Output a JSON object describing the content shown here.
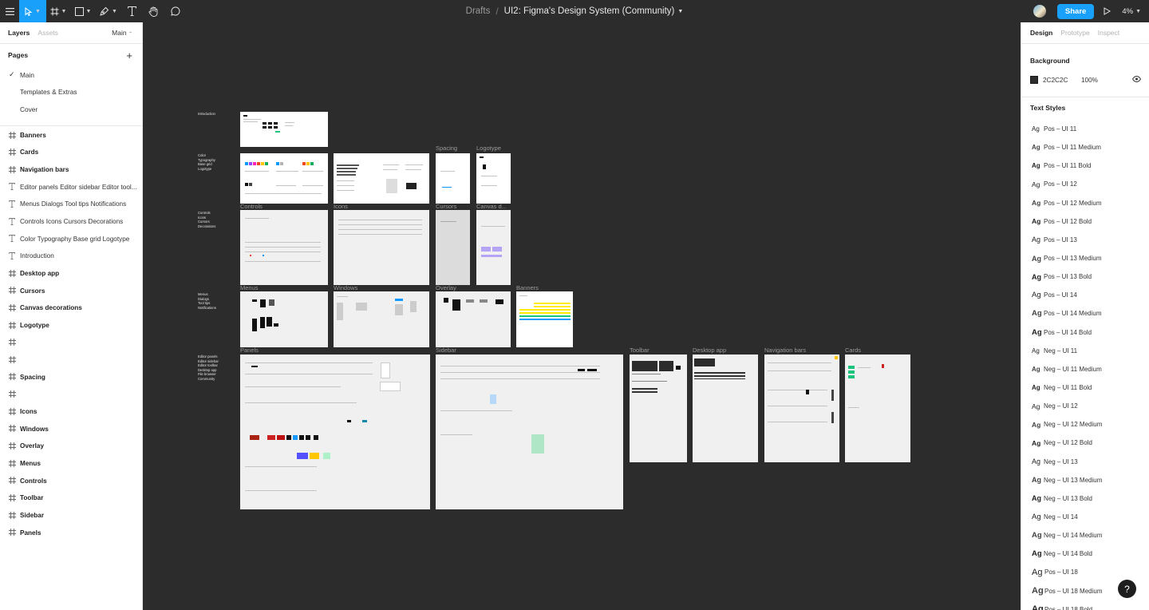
{
  "toolbar": {
    "breadcrumb": "Drafts",
    "separator": "/",
    "doc_title": "UI2: Figma's Design System (Community)",
    "share_label": "Share",
    "zoom": "4%"
  },
  "left_panel": {
    "tabs": [
      "Layers",
      "Assets"
    ],
    "page_selector": "Main",
    "pages_header": "Pages",
    "pages": [
      "Main",
      "Templates & Extras",
      "Cover"
    ],
    "layers": [
      {
        "label": "Banners",
        "type": "frame"
      },
      {
        "label": "Cards",
        "type": "frame"
      },
      {
        "label": "Navigation bars",
        "type": "frame"
      },
      {
        "label": "Editor panels Editor sidebar Editor tool...",
        "type": "text"
      },
      {
        "label": "Menus Dialogs Tool tips Notifications",
        "type": "text"
      },
      {
        "label": "Controls Icons Cursors Decorations",
        "type": "text"
      },
      {
        "label": "Color Typography Base grid Logotype",
        "type": "text"
      },
      {
        "label": "Introduction",
        "type": "text"
      },
      {
        "label": "Desktop app",
        "type": "frame"
      },
      {
        "label": "Cursors",
        "type": "frame"
      },
      {
        "label": "Canvas decorations",
        "type": "frame"
      },
      {
        "label": "Logotype",
        "type": "frame"
      },
      {
        "label": "",
        "type": "frame"
      },
      {
        "label": "",
        "type": "frame"
      },
      {
        "label": "Spacing",
        "type": "frame"
      },
      {
        "label": "",
        "type": "frame"
      },
      {
        "label": "Icons",
        "type": "frame"
      },
      {
        "label": "Windows",
        "type": "frame"
      },
      {
        "label": "Overlay",
        "type": "frame"
      },
      {
        "label": "Menus",
        "type": "frame"
      },
      {
        "label": "Controls",
        "type": "frame"
      },
      {
        "label": "Toolbar",
        "type": "frame"
      },
      {
        "label": "Sidebar",
        "type": "frame"
      },
      {
        "label": "Panels",
        "type": "frame"
      }
    ]
  },
  "right_panel": {
    "tabs": [
      "Design",
      "Prototype",
      "Inspect"
    ],
    "background_title": "Background",
    "background_hex": "2C2C2C",
    "background_opacity": "100%",
    "text_styles_title": "Text Styles",
    "text_styles": [
      {
        "ag": "Ag",
        "name": "Pos – UI 11",
        "size": 8,
        "weight": "normal"
      },
      {
        "ag": "Ag",
        "name": "Pos – UI 11 Medium",
        "size": 8,
        "weight": "500"
      },
      {
        "ag": "Ag",
        "name": "Pos – UI 11 Bold",
        "size": 8,
        "weight": "bold"
      },
      {
        "ag": "Ag",
        "name": "Pos – UI 12",
        "size": 8.5,
        "weight": "normal"
      },
      {
        "ag": "Ag",
        "name": "Pos – UI 12 Medium",
        "size": 8.5,
        "weight": "500"
      },
      {
        "ag": "Ag",
        "name": "Pos – UI 12 Bold",
        "size": 8.5,
        "weight": "bold"
      },
      {
        "ag": "Ag",
        "name": "Pos – UI 13",
        "size": 9,
        "weight": "normal"
      },
      {
        "ag": "Ag",
        "name": "Pos – UI 13 Medium",
        "size": 9,
        "weight": "500"
      },
      {
        "ag": "Ag",
        "name": "Pos – UI 13 Bold",
        "size": 9,
        "weight": "bold"
      },
      {
        "ag": "Ag",
        "name": "Pos – UI 14",
        "size": 9.5,
        "weight": "normal"
      },
      {
        "ag": "Ag",
        "name": "Pos – UI 14 Medium",
        "size": 9.5,
        "weight": "500"
      },
      {
        "ag": "Ag",
        "name": "Pos – UI 14 Bold",
        "size": 9.5,
        "weight": "bold"
      },
      {
        "ag": "Ag",
        "name": "Neg – UI 11",
        "size": 8,
        "weight": "normal"
      },
      {
        "ag": "Ag",
        "name": "Neg – UI 11 Medium",
        "size": 8,
        "weight": "500"
      },
      {
        "ag": "Ag",
        "name": "Neg – UI 11 Bold",
        "size": 8,
        "weight": "bold"
      },
      {
        "ag": "Ag",
        "name": "Neg – UI 12",
        "size": 8.5,
        "weight": "normal"
      },
      {
        "ag": "Ag",
        "name": "Neg – UI 12 Medium",
        "size": 8.5,
        "weight": "500"
      },
      {
        "ag": "Ag",
        "name": "Neg – UI 12 Bold",
        "size": 8.5,
        "weight": "bold"
      },
      {
        "ag": "Ag",
        "name": "Neg – UI 13",
        "size": 9,
        "weight": "normal"
      },
      {
        "ag": "Ag",
        "name": "Neg – UI 13 Medium",
        "size": 9,
        "weight": "500"
      },
      {
        "ag": "Ag",
        "name": "Neg – UI 13 Bold",
        "size": 9,
        "weight": "bold"
      },
      {
        "ag": "Ag",
        "name": "Neg – UI 14",
        "size": 9.5,
        "weight": "normal"
      },
      {
        "ag": "Ag",
        "name": "Neg – UI 14 Medium",
        "size": 9.5,
        "weight": "500"
      },
      {
        "ag": "Ag",
        "name": "Neg – UI 14 Bold",
        "size": 9.5,
        "weight": "bold"
      },
      {
        "ag": "Ag",
        "name": "Pos – UI 18",
        "size": 11,
        "weight": "normal"
      },
      {
        "ag": "Ag",
        "name": "Pos – UI 18 Medium",
        "size": 11,
        "weight": "500"
      },
      {
        "ag": "Ag",
        "name": "Pos – UI 18 Bold",
        "size": 11,
        "weight": "bold"
      }
    ],
    "help_label": "?"
  },
  "canvas": {
    "section_labels": {
      "intro": "Introduction",
      "color": "Color\nTypography\nBase grid\nLogotype",
      "controls": "Controls\nIcons\nCursors\nDecorations",
      "menus": "Menus\nDialogs\nTool tips\nNotifications",
      "editor": "Editor panels\nEditor sidebar\nEditor toolbar\nDesktop app\nFile browser\nCommunity"
    },
    "frame_labels": {
      "spacing": "Spacing",
      "logotype": "Logotype",
      "controls": "Controls",
      "icons": "Icons",
      "cursors": "Cursors",
      "canvas_d": "Canvas d...",
      "menus": "Menus",
      "windows": "Windows",
      "overlay": "Overlay",
      "banners": "Banners",
      "panels": "Panels",
      "sidebar": "Sidebar",
      "toolbar": "Toolbar",
      "desktop": "Desktop app",
      "navbars": "Navigation bars",
      "cards": "Cards"
    }
  },
  "colors": {
    "accent": "#18a0fb",
    "canvas_bg": "#2c2c2c"
  }
}
